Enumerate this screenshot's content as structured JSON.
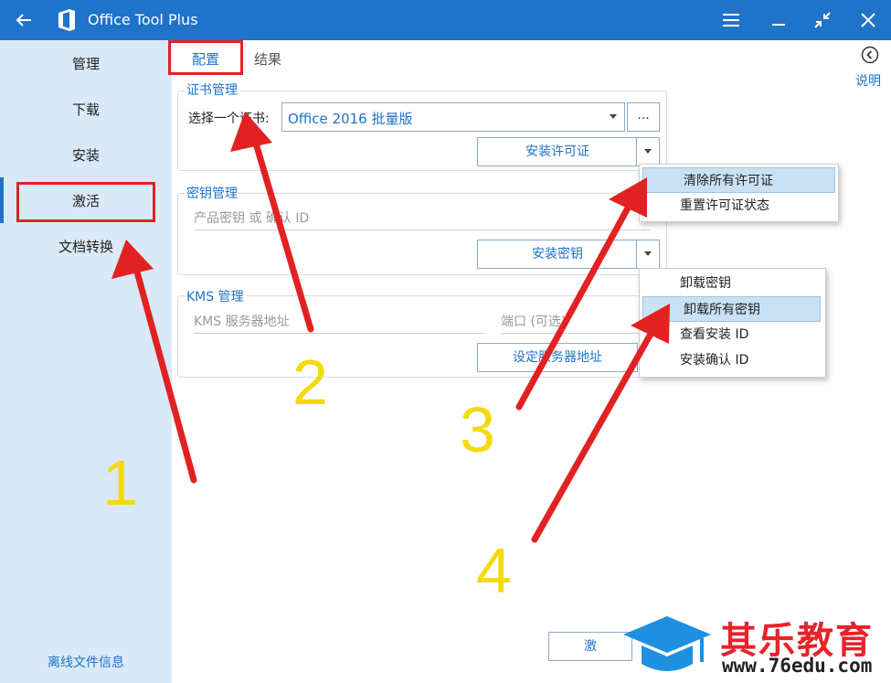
{
  "window": {
    "title": "Office Tool Plus",
    "accent_color": "#1f73c9"
  },
  "sidebar": {
    "items": [
      {
        "label": "管理"
      },
      {
        "label": "下载"
      },
      {
        "label": "安装"
      },
      {
        "label": "激活"
      },
      {
        "label": "文档转换"
      }
    ],
    "active_index": 3,
    "bottom_link": "离线文件信息"
  },
  "tabs": [
    {
      "label": "配置",
      "active": true
    },
    {
      "label": "结果",
      "active": false
    }
  ],
  "help": {
    "label": "说明"
  },
  "cert_group": {
    "title": "证书管理",
    "select_label": "选择一个证书:",
    "selected_cert": "Office 2016 批量版",
    "browse_label": "...",
    "install_button": "安装许可证",
    "menu": [
      {
        "label": "清除所有许可证",
        "highlighted": true
      },
      {
        "label": "重置许可证状态",
        "highlighted": false
      }
    ]
  },
  "key_group": {
    "title": "密钥管理",
    "key_placeholder": "产品密钥 或 确认 ID",
    "install_button": "安装密钥",
    "menu": [
      {
        "label": "卸载密钥",
        "highlighted": false
      },
      {
        "label": "卸载所有密钥",
        "highlighted": true
      },
      {
        "label": "查看安装 ID",
        "highlighted": false
      },
      {
        "label": "安装确认 ID",
        "highlighted": false
      }
    ]
  },
  "kms_group": {
    "title": "KMS 管理",
    "server_placeholder": "KMS 服务器地址",
    "port_placeholder": "端口 (可选)",
    "set_button": "设定服务器地址"
  },
  "bottom_button": "激",
  "annotations": {
    "numbers": [
      "1",
      "2",
      "3",
      "4"
    ],
    "arrow_color": "#e22222",
    "number_color": "#f5d90c"
  },
  "watermark": {
    "text": "其乐教育",
    "url": "www.76edu.com"
  }
}
